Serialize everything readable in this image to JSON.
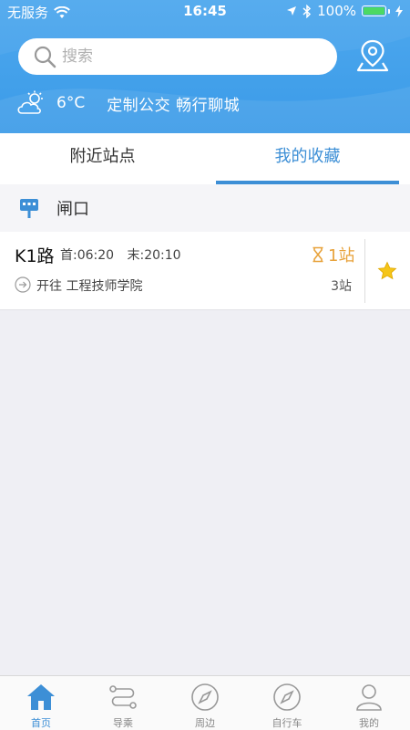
{
  "status_bar": {
    "carrier": "无服务",
    "time": "16:45",
    "battery": "100%"
  },
  "search": {
    "placeholder": "搜索"
  },
  "weather": {
    "temperature": "6°C",
    "slogan": "定制公交 畅行聊城"
  },
  "tabs": [
    {
      "label": "附近站点",
      "active": false
    },
    {
      "label": "我的收藏",
      "active": true
    }
  ],
  "station": {
    "name": "闸口"
  },
  "route": {
    "name": "K1路",
    "first_bus": "首:06:20",
    "last_bus": "末:20:10",
    "direction": "开往 工程技师学院",
    "eta": "1站",
    "stops": "3站"
  },
  "tabbar": [
    {
      "label": "首页",
      "icon": "home-icon",
      "active": true
    },
    {
      "label": "导乘",
      "icon": "route-icon",
      "active": false
    },
    {
      "label": "周边",
      "icon": "compass-icon",
      "active": false
    },
    {
      "label": "自行车",
      "icon": "compass-icon",
      "active": false
    },
    {
      "label": "我的",
      "icon": "user-icon",
      "active": false
    }
  ],
  "colors": {
    "header_blue": "#3b9be8",
    "accent_blue": "#3d8fd6",
    "eta_orange": "#e8a33c",
    "star_yellow": "#f5c518"
  }
}
